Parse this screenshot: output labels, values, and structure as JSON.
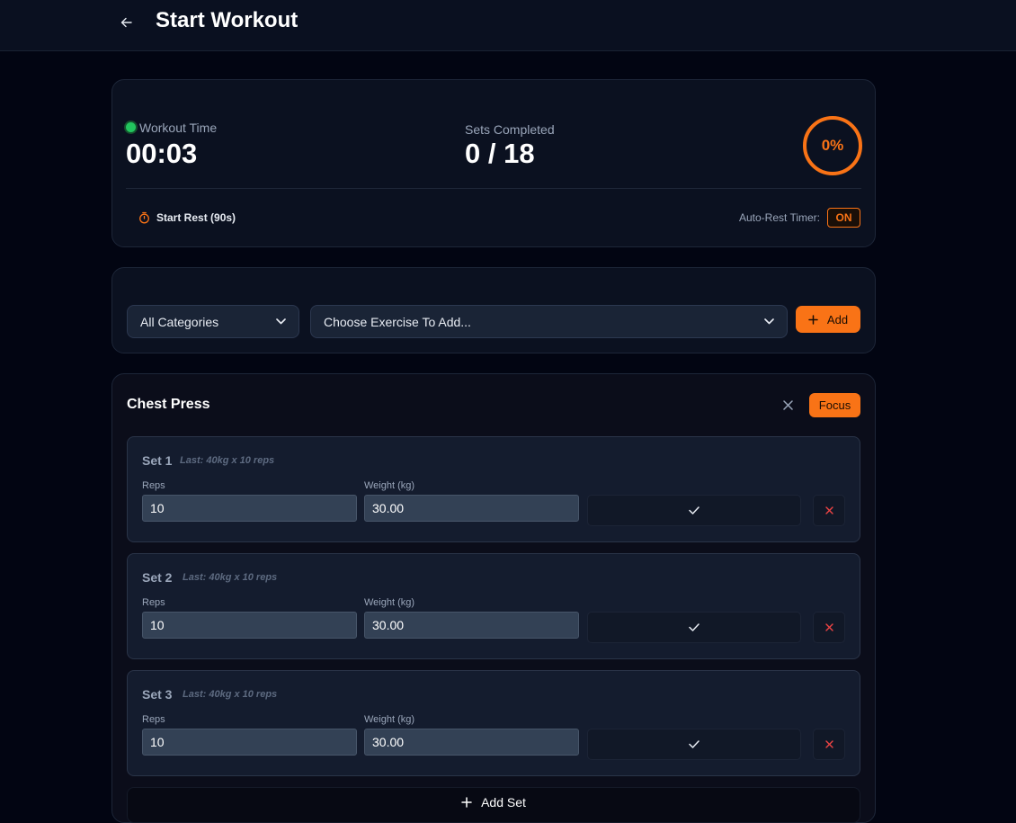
{
  "header": {
    "title": "Start Workout"
  },
  "stats": {
    "workout_time_label": "Workout Time",
    "workout_time": "00:03",
    "sets_label": "Sets Completed",
    "sets_value": "0 / 18",
    "progress_text": "0%",
    "progress": 0,
    "rest_button": "Start Rest (90s)",
    "auto_rest_label": "Auto-Rest Timer:",
    "auto_rest_state": "ON"
  },
  "adder": {
    "category_selected": "All Categories",
    "exercise_selected": "Choose Exercise To Add...",
    "add_label": "Add"
  },
  "exercise": {
    "name": "Chest Press",
    "focus_label": "Focus",
    "reps_label": "Reps",
    "weight_label": "Weight (kg)",
    "sets": [
      {
        "title": "Set 1",
        "last": "Last: 40kg x 10 reps",
        "reps": "10",
        "weight": "30.00"
      },
      {
        "title": "Set 2",
        "last": "Last: 40kg x 10 reps",
        "reps": "10",
        "weight": "30.00"
      },
      {
        "title": "Set 3",
        "last": "Last: 40kg x 10 reps",
        "reps": "10",
        "weight": "30.00"
      }
    ],
    "add_set_label": "Add Set"
  },
  "colors": {
    "accent": "#f97316",
    "success": "#22c55e",
    "danger": "#ef4444",
    "background": "#020512"
  },
  "icons": [
    "arrow-left-icon",
    "status-dot-icon",
    "stopwatch-icon",
    "chevron-down-icon",
    "plus-icon",
    "close-icon",
    "check-icon"
  ]
}
